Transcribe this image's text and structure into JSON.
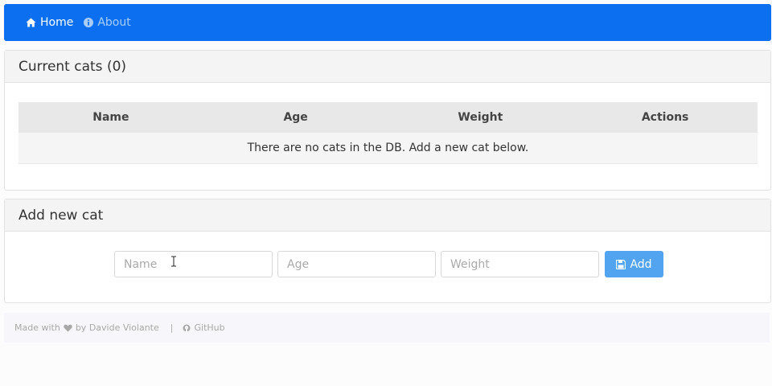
{
  "nav": {
    "home_label": "Home",
    "home_icon": "home-icon",
    "about_label": "About",
    "about_icon": "info-icon"
  },
  "cats_panel": {
    "title": "Current cats (0)",
    "columns": [
      "Name",
      "Age",
      "Weight",
      "Actions"
    ],
    "empty_message": "There are no cats in the DB. Add a new cat below."
  },
  "add_panel": {
    "title": "Add new cat",
    "name_placeholder": "Name",
    "age_placeholder": "Age",
    "weight_placeholder": "Weight",
    "add_label": "Add",
    "add_icon": "floppy-disk-icon"
  },
  "footer": {
    "made_with": "Made with",
    "heart_icon": "heart-icon",
    "by_author": "by Davide Violante",
    "separator": "|",
    "github_label": "GitHub",
    "github_icon": "github-icon"
  },
  "colors": {
    "navbar": "#0b6ff0",
    "add_button": "#52a3f0"
  }
}
